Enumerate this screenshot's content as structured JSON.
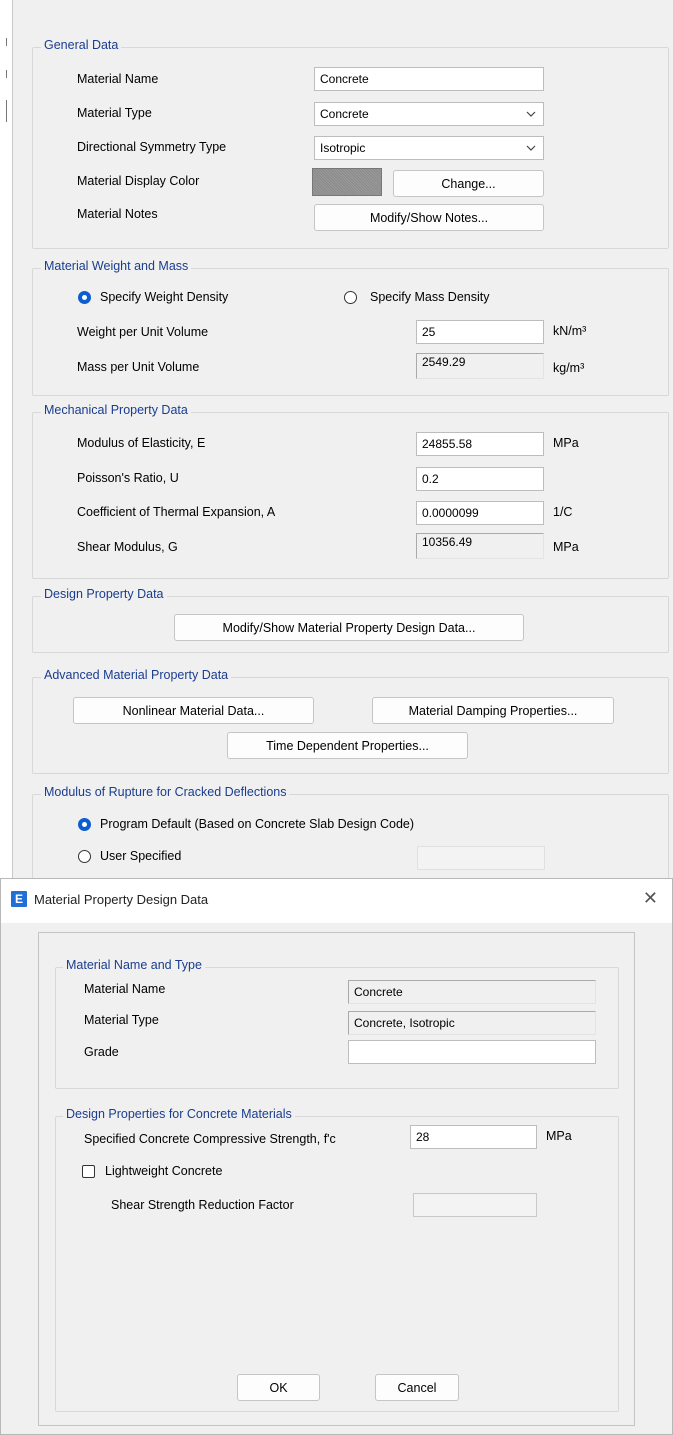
{
  "material_dialog": {
    "general": {
      "legend": "General Data",
      "material_name_label": "Material Name",
      "material_name_value": "Concrete",
      "material_type_label": "Material Type",
      "material_type_value": "Concrete",
      "symmetry_label": "Directional Symmetry Type",
      "symmetry_value": "Isotropic",
      "display_color_label": "Material Display Color",
      "display_color": "#8f8f8f",
      "change_button": "Change...",
      "notes_label": "Material Notes",
      "notes_button": "Modify/Show Notes..."
    },
    "weight_mass": {
      "legend": "Material Weight and Mass",
      "radio_weight": "Specify Weight Density",
      "radio_mass": "Specify Mass Density",
      "weight_label": "Weight per Unit Volume",
      "weight_value": "25",
      "weight_unit": "kN/m³",
      "mass_label": "Mass per Unit Volume",
      "mass_value": "2549.29",
      "mass_unit": "kg/m³"
    },
    "mechanical": {
      "legend": "Mechanical Property Data",
      "elasticity_label": "Modulus of Elasticity,  E",
      "elasticity_value": "24855.58",
      "elasticity_unit": "MPa",
      "poisson_label": "Poisson's Ratio,  U",
      "poisson_value": "0.2",
      "thermal_label": "Coefficient of Thermal Expansion,  A",
      "thermal_value": "0.0000099",
      "thermal_unit": "1/C",
      "shear_label": "Shear Modulus,  G",
      "shear_value": "10356.49",
      "shear_unit": "MPa"
    },
    "design": {
      "legend": "Design Property Data",
      "button": "Modify/Show Material Property Design Data..."
    },
    "advanced": {
      "legend": "Advanced Material Property Data",
      "nonlinear_button": "Nonlinear Material Data...",
      "damping_button": "Material Damping Properties...",
      "time_button": "Time Dependent Properties..."
    },
    "rupture": {
      "legend": "Modulus of Rupture for Cracked Deflections",
      "radio_default": "Program Default  (Based on Concrete Slab Design Code)",
      "radio_user": "User Specified"
    }
  },
  "design_dialog": {
    "title": "Material Property Design Data",
    "app_icon_letter": "E",
    "name_type": {
      "legend": "Material Name and Type",
      "name_label": "Material Name",
      "name_value": "Concrete",
      "type_label": "Material Type",
      "type_value": "Concrete, Isotropic",
      "grade_label": "Grade",
      "grade_value": ""
    },
    "concrete": {
      "legend": "Design Properties for Concrete Materials",
      "fc_label": "Specified Concrete Compressive Strength, f'c",
      "fc_value": "28",
      "fc_unit": "MPa",
      "lightweight_label": "Lightweight Concrete",
      "shear_factor_label": "Shear Strength Reduction Factor"
    },
    "ok_button": "OK",
    "cancel_button": "Cancel"
  }
}
